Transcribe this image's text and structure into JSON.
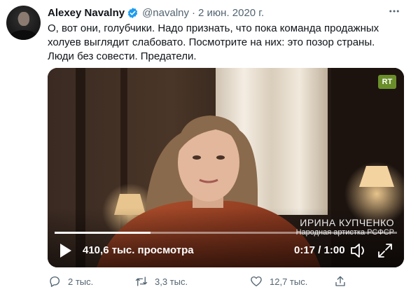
{
  "tweet": {
    "author_name": "Alexey Navalny",
    "handle": "@navalny",
    "date": "2 июн. 2020 г.",
    "separator": "·",
    "text": "О, вот они, голубчики. Надо признать, что пока команда продажных холуев выглядит слабовато. Посмотрите на них: это позор страны. Люди без совести. Предатели.",
    "verified": true,
    "more_icon": "more-horizontal-icon"
  },
  "video": {
    "channel_logo_text": "RT",
    "caption_name": "ИРИНА КУПЧЕНКО",
    "caption_title": "Народная артистка РСФСР",
    "views": "410,6 тыс. просмотра",
    "time": "0:17 / 1:00",
    "progress_fraction": 0.28,
    "play_icon": "play-icon",
    "volume_icon": "volume-icon",
    "fullscreen_icon": "fullscreen-icon"
  },
  "actions": {
    "reply_count": "2 тыс.",
    "retweet_count": "3,3 тыс.",
    "like_count": "12,7 тыс.",
    "reply_icon": "reply-icon",
    "retweet_icon": "retweet-icon",
    "like_icon": "heart-icon",
    "share_icon": "share-icon"
  },
  "colors": {
    "verified_blue": "#1d9bf0",
    "muted_text": "#536471",
    "rt_green": "#6a8f2a"
  }
}
